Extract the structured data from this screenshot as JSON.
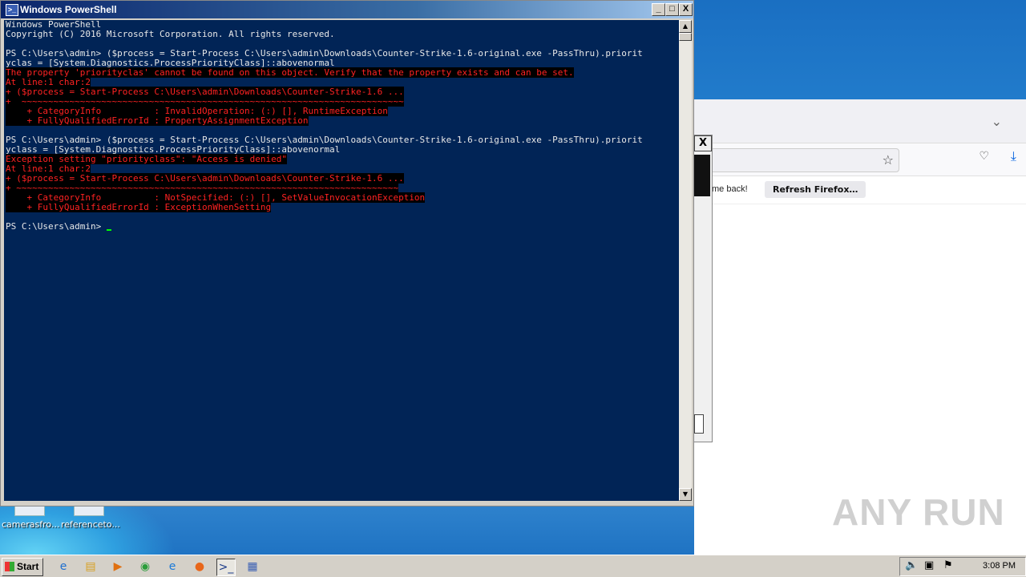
{
  "powershell": {
    "title": "Windows PowerShell",
    "lines": [
      {
        "text": "Windows PowerShell",
        "err": false
      },
      {
        "text": "Copyright (C) 2016 Microsoft Corporation. All rights reserved.",
        "err": false
      },
      {
        "text": "",
        "err": false
      },
      {
        "text": "PS C:\\Users\\admin> ($process = Start-Process C:\\Users\\admin\\Downloads\\Counter-Strike-1.6-original.exe -PassThru).priorit",
        "err": false
      },
      {
        "text": "yclas = [System.Diagnostics.ProcessPriorityClass]::abovenormal",
        "err": false
      },
      {
        "text": "The property 'priorityclas' cannot be found on this object. Verify that the property exists and can be set.",
        "err": true
      },
      {
        "text": "At line:1 char:2",
        "err": true
      },
      {
        "text": "+ ($process = Start-Process C:\\Users\\admin\\Downloads\\Counter-Strike-1.6 ...",
        "err": true
      },
      {
        "text": "+  ~~~~~~~~~~~~~~~~~~~~~~~~~~~~~~~~~~~~~~~~~~~~~~~~~~~~~~~~~~~~~~~~~~~~~~~~",
        "err": true
      },
      {
        "text": "    + CategoryInfo          : InvalidOperation: (:) [], RuntimeException",
        "err": true
      },
      {
        "text": "    + FullyQualifiedErrorId : PropertyAssignmentException",
        "err": true
      },
      {
        "text": "",
        "err": false
      },
      {
        "text": "PS C:\\Users\\admin> ($process = Start-Process C:\\Users\\admin\\Downloads\\Counter-Strike-1.6-original.exe -PassThru).priorit",
        "err": false
      },
      {
        "text": "yclass = [System.Diagnostics.ProcessPriorityClass]::abovenormal",
        "err": false
      },
      {
        "text": "Exception setting \"priorityclass\": \"Access is denied\"",
        "err": true
      },
      {
        "text": "At line:1 char:2",
        "err": true
      },
      {
        "text": "+ ($process = Start-Process C:\\Users\\admin\\Downloads\\Counter-Strike-1.6 ...",
        "err": true
      },
      {
        "text": "+ ~~~~~~~~~~~~~~~~~~~~~~~~~~~~~~~~~~~~~~~~~~~~~~~~~~~~~~~~~~~~~~~~~~~~~~~~",
        "err": true
      },
      {
        "text": "    + CategoryInfo          : NotSpecified: (:) [], SetValueInvocationException",
        "err": true
      },
      {
        "text": "    + FullyQualifiedErrorId : ExceptionWhenSetting",
        "err": true
      },
      {
        "text": "",
        "err": false
      }
    ],
    "prompt": "PS C:\\Users\\admin> ",
    "controls": {
      "minimize": "_",
      "maximize": "□",
      "close": "X"
    }
  },
  "firefox": {
    "notification_text": "me back!",
    "refresh_button": "Refresh Firefox…"
  },
  "dialog": {
    "close": "X"
  },
  "desktop_icons": [
    {
      "label": "camerasfro..."
    },
    {
      "label": "referenceto..."
    }
  ],
  "watermark": "ANY RUN",
  "taskbar": {
    "start_label": "Start",
    "clock": "3:08 PM",
    "icons": [
      "ie-icon",
      "explorer-icon",
      "media-player-icon",
      "chrome-icon",
      "edge-icon",
      "firefox-icon",
      "powershell-icon",
      "taskbar-app-icon"
    ]
  }
}
